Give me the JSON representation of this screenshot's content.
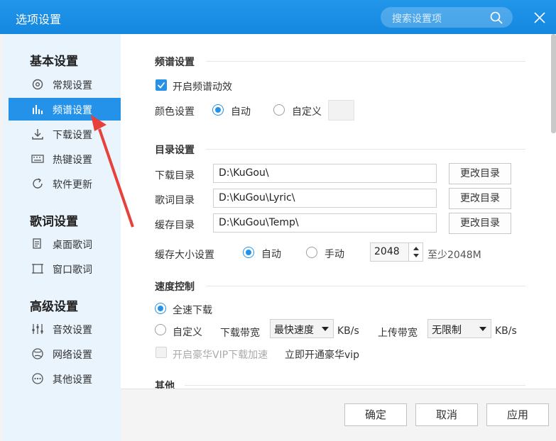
{
  "window": {
    "title": "选项设置",
    "search_placeholder": "搜索设置项",
    "close_label": "×"
  },
  "sidebar": {
    "groups": [
      {
        "title": "基本设置",
        "items": [
          {
            "label": "常规设置",
            "icon": "gear-icon"
          },
          {
            "label": "频谱设置",
            "icon": "spectrum-icon",
            "active": true
          },
          {
            "label": "下载设置",
            "icon": "download-icon"
          },
          {
            "label": "热键设置",
            "icon": "keyboard-icon"
          },
          {
            "label": "软件更新",
            "icon": "update-icon"
          }
        ]
      },
      {
        "title": "歌词设置",
        "items": [
          {
            "label": "桌面歌词",
            "icon": "desktop-lyric-icon"
          },
          {
            "label": "窗口歌词",
            "icon": "window-lyric-icon"
          }
        ]
      },
      {
        "title": "高级设置",
        "items": [
          {
            "label": "音效设置",
            "icon": "equalizer-icon"
          },
          {
            "label": "网络设置",
            "icon": "network-icon"
          },
          {
            "label": "其他设置",
            "icon": "more-icon"
          }
        ]
      }
    ]
  },
  "spectrum": {
    "title": "频谱设置",
    "enable_label": "开启频谱动效",
    "enable_checked": true,
    "color_label": "颜色设置",
    "auto_label": "自动",
    "custom_label": "自定义",
    "selected": "auto"
  },
  "directory": {
    "title": "目录设置",
    "rows": [
      {
        "label": "下载目录",
        "path": "D:\\KuGou\\",
        "button": "更改目录"
      },
      {
        "label": "歌词目录",
        "path": "D:\\KuGou\\Lyric\\",
        "button": "更改目录"
      },
      {
        "label": "缓存目录",
        "path": "D:\\KuGou\\Temp\\",
        "button": "更改目录"
      }
    ],
    "cache_size_label": "缓存大小设置",
    "cache_auto_label": "自动",
    "cache_manual_label": "手动",
    "cache_value": "2048",
    "cache_hint": "至少2048M"
  },
  "speed": {
    "title": "速度控制",
    "full_speed_label": "全速下载",
    "custom_label": "自定义",
    "download_bw_label": "下载带宽",
    "download_bw_value": "最快速度",
    "unit": "KB/s",
    "upload_bw_label": "上传带宽",
    "upload_bw_value": "无限制",
    "vip_boost_label": "开启豪华VIP下载加速",
    "vip_link": "立即开通豪华vip"
  },
  "other": {
    "title": "其他"
  },
  "footer": {
    "ok": "确定",
    "cancel": "取消",
    "apply": "应用"
  },
  "colors": {
    "accent": "#2392e8",
    "titlebar": "#1a8ee5",
    "sidebar_bg": "#eaf4fd",
    "annotation": "#e8403a"
  }
}
